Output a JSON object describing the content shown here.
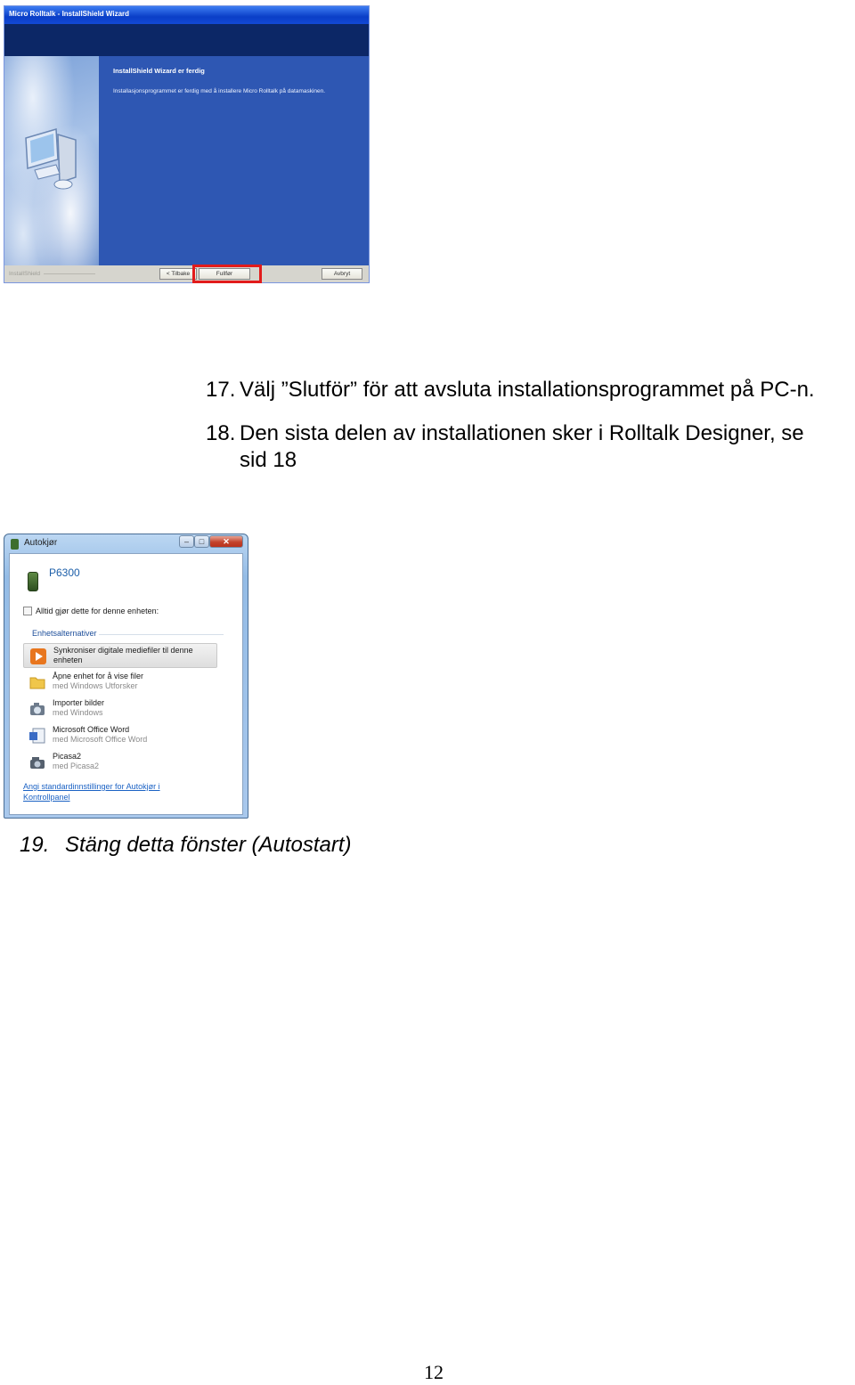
{
  "wizard": {
    "title": "Micro Rolltalk - InstallShield Wizard",
    "heading": "InstallShield Wizard er ferdig",
    "message": "Installasjonsprogrammet er ferdig med å installere Micro Rolltalk på datamaskinen.",
    "brand": "InstallShield",
    "back_label": "< Tilbake",
    "finish_label": "Fullfør",
    "cancel_label": "Avbryt",
    "highlight_color": "#e21b1b"
  },
  "steps": [
    {
      "number": "17.",
      "text": "Välj ”Slutför” för att avsluta installationsprogrammet på PC-n."
    },
    {
      "number": "18.",
      "line1": "Den sista delen av installationen sker i Rolltalk Designer, se",
      "line2": "sid 18"
    },
    {
      "number": "19.",
      "text": "Stäng detta fönster (Autostart)"
    }
  ],
  "autoplay": {
    "title": "Autokjør",
    "device": "P6300",
    "checkbox_label": "Alltid gjør dette for denne enheten:",
    "section": "Enhetsalternativer",
    "options": [
      {
        "line1": "Synkroniser digitale mediefiler til denne",
        "line2": "enheten",
        "icon": "media-sync-icon"
      },
      {
        "line1": "Åpne enhet for å vise filer",
        "line2": "med Windows Utforsker",
        "icon": "folder-icon"
      },
      {
        "line1": "Importer bilder",
        "line2": "med Windows",
        "icon": "camera-icon"
      },
      {
        "line1": "Microsoft Office Word",
        "line2": "med Microsoft Office Word",
        "icon": "word-document-icon"
      },
      {
        "line1": "Picasa2",
        "line2": "med Picasa2",
        "icon": "picasa-camera-icon"
      }
    ],
    "link_line1": "Angi standardinnstillinger for Autokjør i",
    "link_line2": "Kontrollpanel",
    "window_buttons": {
      "minimize": "–",
      "maximize": "□",
      "close": "✕"
    }
  },
  "page_number": "12"
}
